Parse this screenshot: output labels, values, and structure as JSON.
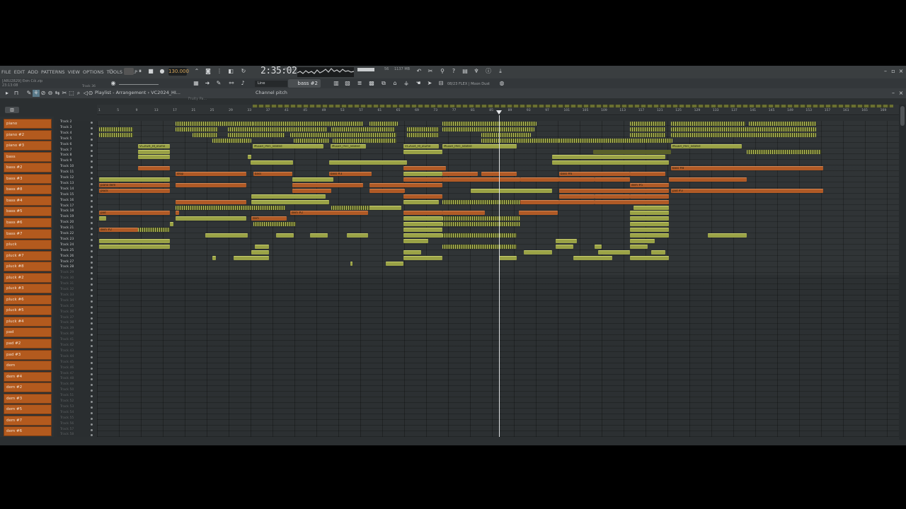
{
  "menu": [
    "FILE",
    "EDIT",
    "ADD",
    "PATTERNS",
    "VIEW",
    "OPTIONS",
    "TOOLS",
    "HELP"
  ],
  "transport": {
    "tempo": "130.000",
    "song_time": "2:35:02",
    "time_unit": "M:S:CS"
  },
  "project": {
    "line1": "[ARU2829] Đơn Côi.zip",
    "line2": "23:13:08",
    "track_hint": "Track 36"
  },
  "cpu": {
    "value": "56",
    "mem": "1137 MB"
  },
  "snap": "Line",
  "pattern_selector": "bass #2",
  "hint": "08/23 FLEX | Moon Dust",
  "playlist": {
    "title": "Playlist - Arrangement › VC2024_HI...",
    "channel": "Channel pitch",
    "ghost_label": "Fruity Pa..."
  },
  "patterns": [
    "piano",
    "piano #2",
    "piano #3",
    "bass",
    "bass #2",
    "bass #3",
    "bass #8",
    "bass #4",
    "bass #5",
    "bass #6",
    "bass #7",
    "pluck",
    "pluck #7",
    "pluck #8",
    "pluck #2",
    "pluck #3",
    "pluck #6",
    "pluck #5",
    "pluck #4",
    "pad",
    "pad #2",
    "pad #3",
    "dem",
    "dem #4",
    "dem #2",
    "dem #3",
    "dem #5",
    "dem #7",
    "dem #6"
  ],
  "tracks_count": 58,
  "active_tracks": 28,
  "ruler_start": 1,
  "ruler_step": 4,
  "ruler_count": 43,
  "clip_labels": {
    "drop": "drop",
    "bass": "bass",
    "bass3": "bass #3",
    "pluck": "pluck",
    "pluck3": "pluck #3",
    "piano": "piano",
    "pianodem": "piano dem",
    "pad": "pad",
    "dem": "dem",
    "dem2": "dem #2",
    "pad3": "pad #3",
    "bass8": "bass #8",
    "bass6": "bass #6",
    "pluck2": "pluck #2",
    "vc": "VC2024_HI_olume",
    "perc": "MLLER_Perc_Iidated",
    "dem5": "dem #5"
  }
}
